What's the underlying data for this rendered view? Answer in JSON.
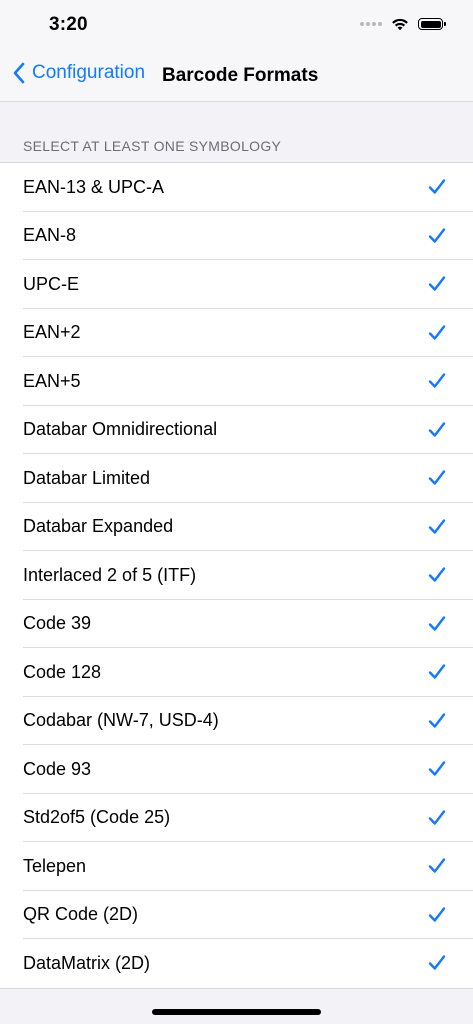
{
  "status_bar": {
    "time": "3:20",
    "icons": [
      "signal-icon",
      "wifi-icon",
      "battery-icon"
    ]
  },
  "nav": {
    "back_label": "Configuration",
    "title": "Barcode Formats"
  },
  "section": {
    "header": "SELECT AT LEAST ONE SYMBOLOGY"
  },
  "items": [
    {
      "label": "EAN-13 & UPC-A",
      "checked": true
    },
    {
      "label": "EAN-8",
      "checked": true
    },
    {
      "label": "UPC-E",
      "checked": true
    },
    {
      "label": "EAN+2",
      "checked": true
    },
    {
      "label": "EAN+5",
      "checked": true
    },
    {
      "label": "Databar Omnidirectional",
      "checked": true
    },
    {
      "label": "Databar Limited",
      "checked": true
    },
    {
      "label": "Databar Expanded",
      "checked": true
    },
    {
      "label": "Interlaced 2 of 5 (ITF)",
      "checked": true
    },
    {
      "label": "Code 39",
      "checked": true
    },
    {
      "label": "Code 128",
      "checked": true
    },
    {
      "label": "Codabar (NW-7, USD-4)",
      "checked": true
    },
    {
      "label": "Code 93",
      "checked": true
    },
    {
      "label": "Std2of5 (Code 25)",
      "checked": true
    },
    {
      "label": "Telepen",
      "checked": true
    },
    {
      "label": "QR Code (2D)",
      "checked": true
    },
    {
      "label": "DataMatrix (2D)",
      "checked": true
    }
  ],
  "colors": {
    "accent": "#1479ff",
    "background": "#f2f2f7",
    "separator": "#dcdce0"
  }
}
